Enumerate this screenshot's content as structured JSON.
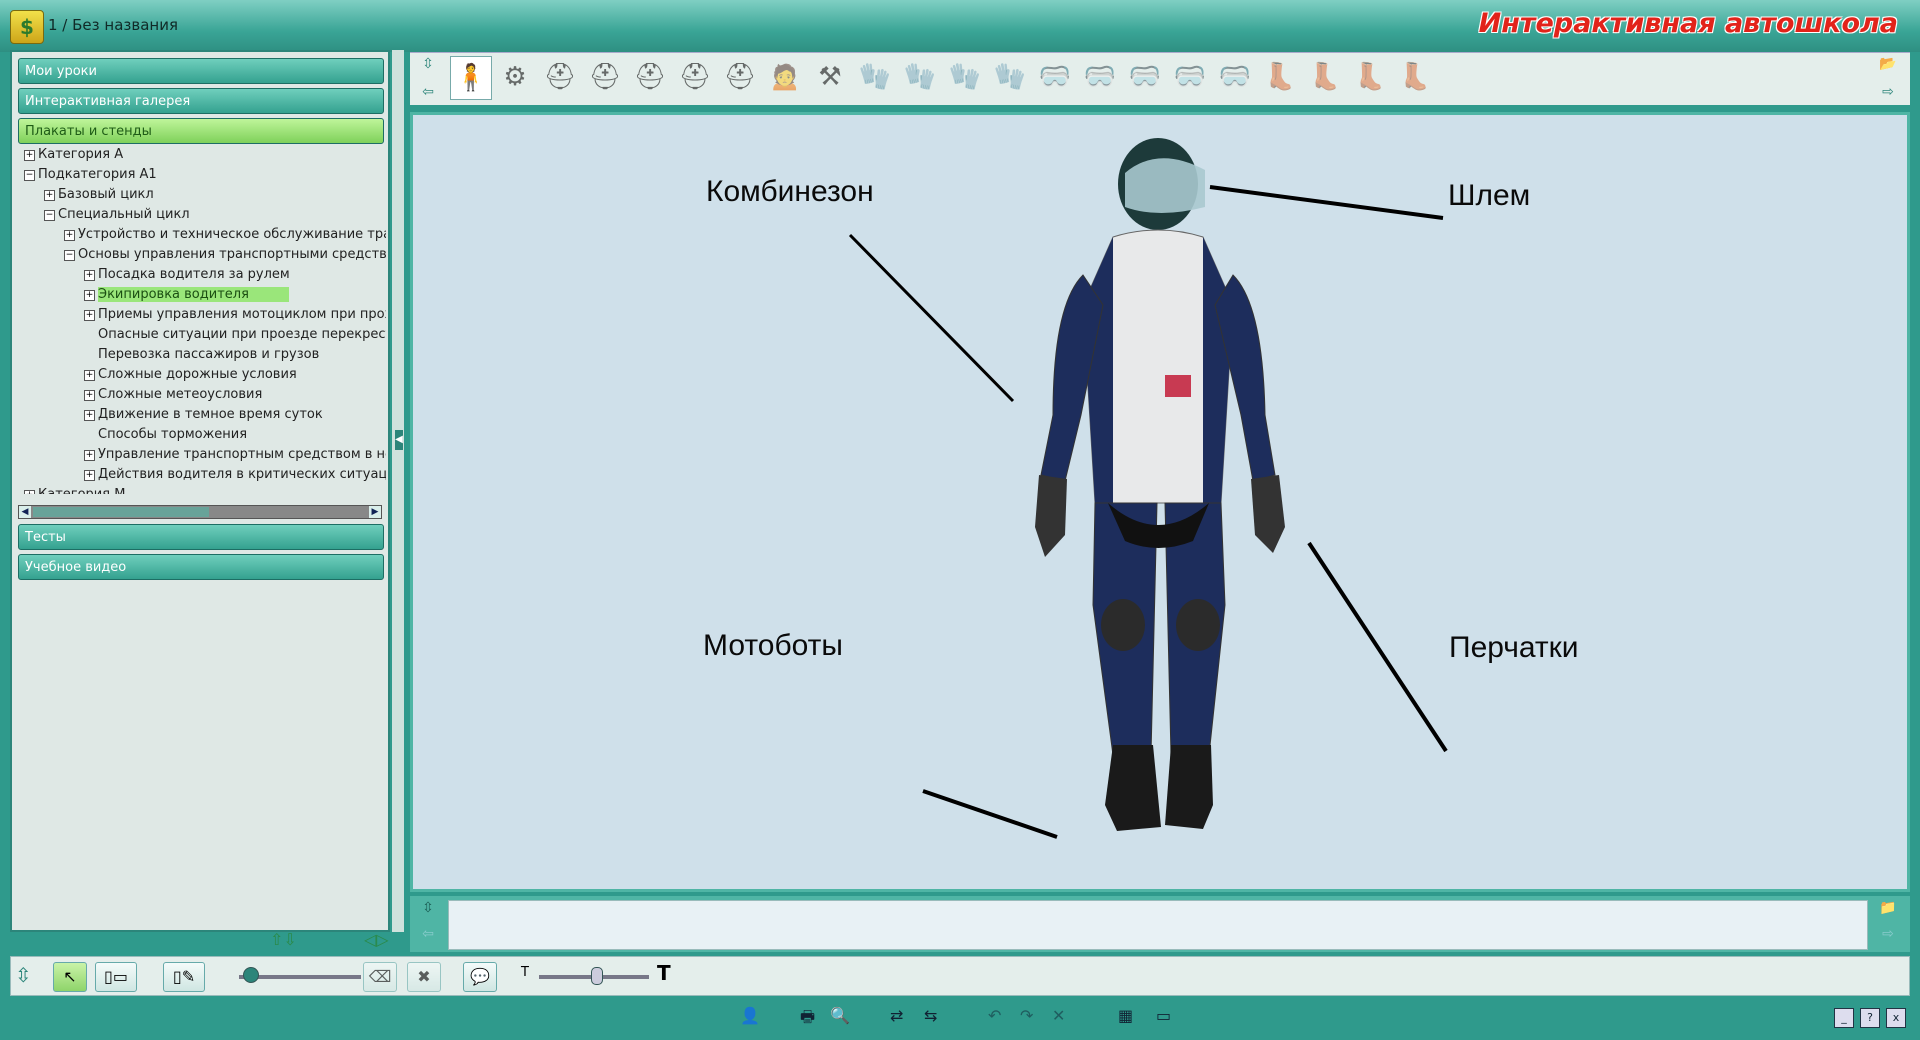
{
  "titlebar": {
    "icon": "app-logo-icon",
    "document_title": "1 / Без названия",
    "brand": "Интерактивная автошкола"
  },
  "sidebar": {
    "sections_top": [
      {
        "label": "Мои уроки",
        "active": false
      },
      {
        "label": "Интерактивная галерея",
        "active": false
      },
      {
        "label": "Плакаты и стенды",
        "active": true
      }
    ],
    "tree": [
      {
        "label": "Категория A",
        "level": 0,
        "expander": "+"
      },
      {
        "label": "Подкатегория A1",
        "level": 0,
        "expander": "−"
      },
      {
        "label": "Базовый цикл",
        "level": 1,
        "expander": "+"
      },
      {
        "label": "Специальный цикл",
        "level": 1,
        "expander": "−"
      },
      {
        "label": "Устройство и техническое обслуживание трансп",
        "level": 2,
        "expander": "+"
      },
      {
        "label": "Основы управления транспортными средствами",
        "level": 2,
        "expander": "−"
      },
      {
        "label": "Посадка водителя за рулем",
        "level": 3,
        "expander": "+"
      },
      {
        "label": "Экипировка водителя",
        "level": 3,
        "expander": "+",
        "selected": true
      },
      {
        "label": "Приемы управления мотоциклом при прохож",
        "level": 3,
        "expander": "+"
      },
      {
        "label": "Опасные ситуации при проезде перекрестко",
        "level": 3,
        "expander": ""
      },
      {
        "label": "Перевозка пассажиров и грузов",
        "level": 3,
        "expander": ""
      },
      {
        "label": "Сложные дорожные условия",
        "level": 3,
        "expander": "+"
      },
      {
        "label": "Сложные метеоусловия",
        "level": 3,
        "expander": "+"
      },
      {
        "label": "Движение в темное время суток",
        "level": 3,
        "expander": "+"
      },
      {
        "label": "Способы торможения",
        "level": 3,
        "expander": ""
      },
      {
        "label": "Управление транспортным средством в нешт",
        "level": 3,
        "expander": "+"
      },
      {
        "label": "Действия водителя в критических ситуациях",
        "level": 3,
        "expander": "+"
      },
      {
        "label": "Категория M",
        "level": 0,
        "expander": "+"
      }
    ],
    "sections_bottom": [
      {
        "label": "Тесты"
      },
      {
        "label": "Учебное видео"
      }
    ]
  },
  "thumbnails": [
    "rider-figure-icon",
    "helmet-parts-icon",
    "helmet-blue-icon",
    "helmet-red-icon",
    "helmet-white-icon",
    "helmet-motocross-icon",
    "helmet-dark-icon",
    "rider-profile-icon",
    "hinge-parts-icon",
    "glove-red-icon",
    "glove-blue-icon",
    "glove-red-2-icon",
    "glove-dark-icon",
    "visor-parts-icon",
    "goggles-icon",
    "goggles-green-icon",
    "goggles-clear-icon",
    "goggles-white-icon",
    "boot-parts-icon",
    "boot-set-icon",
    "boot-pink-icon",
    "boot-dark-icon"
  ],
  "poster": {
    "labels": {
      "suit": "Комбинезон",
      "helmet": "Шлем",
      "boots": "Мотоботы",
      "gloves": "Перчатки"
    }
  },
  "colors": {
    "accent": "#2f9a8c",
    "selected_item": "#9ae67a",
    "brand": "#e2231a"
  }
}
